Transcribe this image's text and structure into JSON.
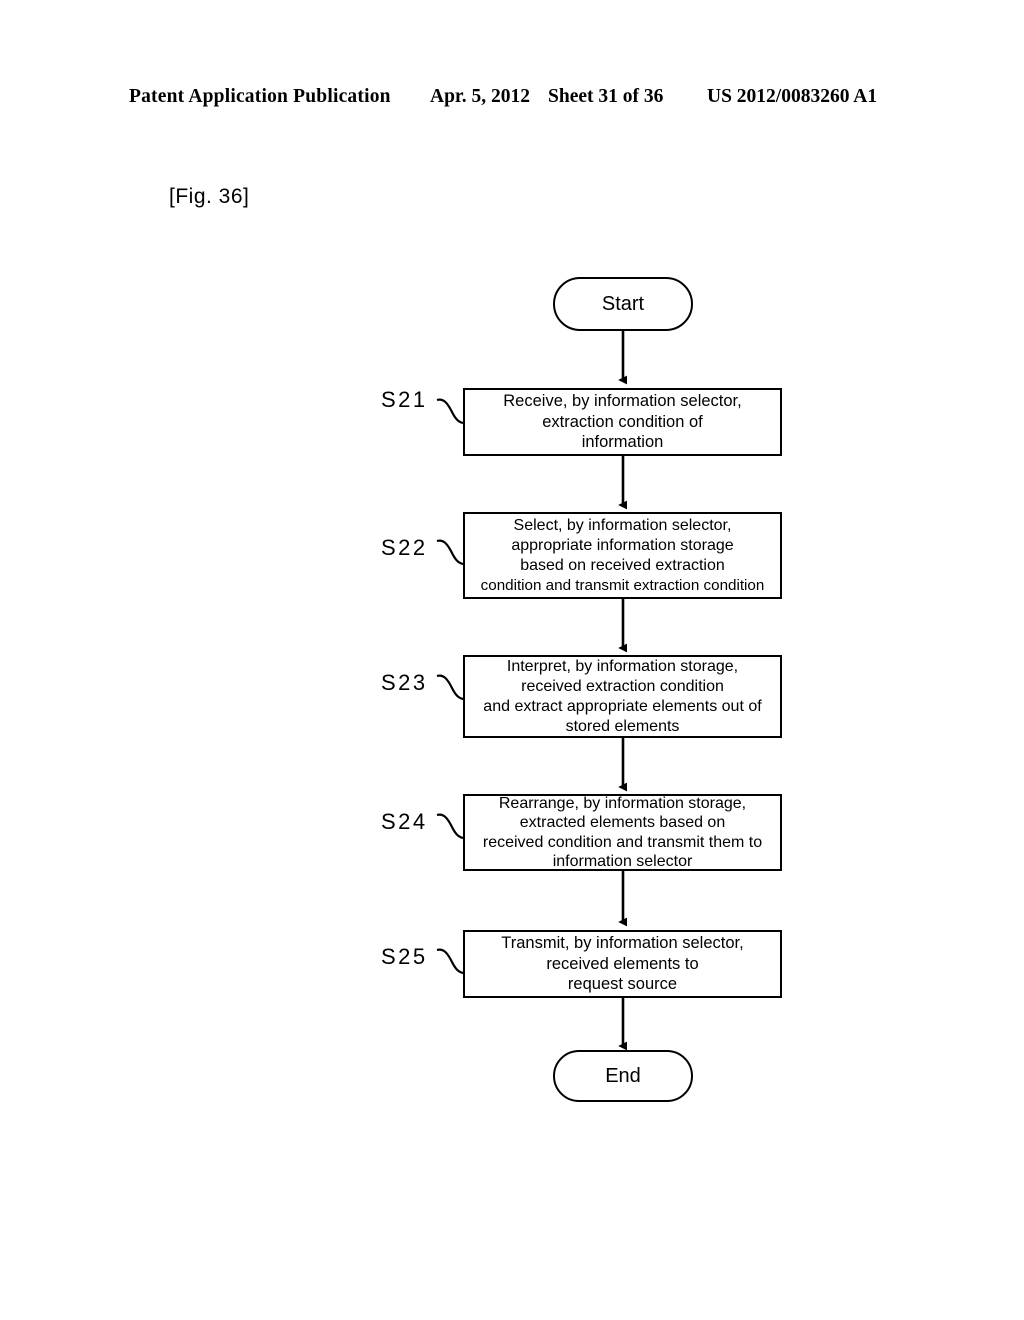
{
  "header": {
    "publication": "Patent Application Publication",
    "date": "Apr. 5, 2012",
    "sheet": "Sheet 31 of 36",
    "number": "US 2012/0083260 A1"
  },
  "figure": {
    "label": "[Fig. 36]"
  },
  "colors": {
    "ink": "#000000",
    "paper": "#ffffff"
  },
  "flowchart": {
    "start": {
      "label": "Start"
    },
    "end": {
      "label": "End"
    },
    "steps": [
      {
        "id": "S21",
        "lines": [
          "Receive, by information selector,",
          "extraction condition of",
          "information"
        ]
      },
      {
        "id": "S22",
        "lines": [
          "Select, by information selector,",
          "appropriate information storage",
          "based on received extraction",
          "condition and transmit extraction condition"
        ]
      },
      {
        "id": "S23",
        "lines": [
          "Interpret, by information storage,",
          "received extraction condition",
          "and extract appropriate elements out of",
          "stored elements"
        ]
      },
      {
        "id": "S24",
        "lines": [
          "Rearrange, by information storage,",
          "extracted elements based on",
          "received condition and transmit them to",
          "information selector"
        ]
      },
      {
        "id": "S25",
        "lines": [
          "Transmit, by information selector,",
          "received elements to",
          "request source"
        ]
      }
    ]
  }
}
